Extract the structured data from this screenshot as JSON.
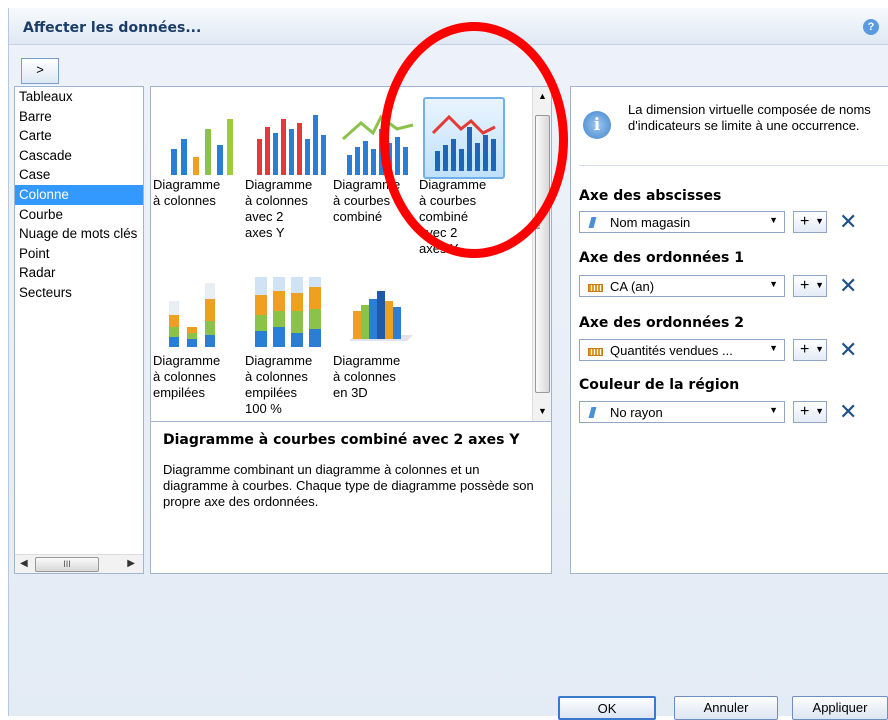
{
  "dialog": {
    "title": "Affecter les données...",
    "help_glyph": "?",
    "expand_label": ">"
  },
  "type_list": {
    "items": [
      "Tableaux",
      "Barre",
      "Carte",
      "Cascade",
      "Case",
      "Colonne",
      "Courbe",
      "Nuage de mots clés",
      "Point",
      "Radar",
      "Secteurs"
    ],
    "selected": "Colonne",
    "scroll_thumb_glyph": "III"
  },
  "gallery": {
    "charts": [
      {
        "label": "Diagramme\nà colonnes",
        "icon": "bar-chart-icon"
      },
      {
        "label": "Diagramme\nà colonnes\navec 2\naxes Y",
        "icon": "dual-axis-bar-chart-icon"
      },
      {
        "label": "Diagramme\nà courbes\ncombiné",
        "icon": "combined-line-bar-chart-icon"
      },
      {
        "label": "Diagramme\nà courbes\ncombiné\navec 2\naxes Y",
        "icon": "combined-line-bar-2axis-chart-icon",
        "selected": true
      },
      {
        "label": "Diagramme\nà colonnes\nempilées",
        "icon": "stacked-bar-chart-icon"
      },
      {
        "label": "Diagramme\nà colonnes\nempilées\n100 %",
        "icon": "stacked-100-bar-chart-icon"
      },
      {
        "label": "Diagramme\nà colonnes\nen 3D",
        "icon": "3d-bar-chart-icon"
      }
    ]
  },
  "description": {
    "title": "Diagramme à courbes combiné avec 2 axes Y",
    "text": "Diagramme combinant un diagramme à colonnes et un diagramme à courbes. Chaque type de diagramme possède son propre axe des ordonnées."
  },
  "right_panel": {
    "info_text": "La dimension virtuelle composée de noms d'indicateurs se limite à une occurrence.",
    "info_glyph": "i",
    "axes": [
      {
        "label": "Axe des abscisses",
        "value": "Nom magasin",
        "kind": "dimension"
      },
      {
        "label": "Axe des ordonnées 1",
        "value": "CA (an)",
        "kind": "measure"
      },
      {
        "label": "Axe des ordonnées 2",
        "value": "Quantités vendues ...",
        "kind": "measure"
      },
      {
        "label": "Couleur de la région",
        "value": "No rayon",
        "kind": "dimension"
      }
    ],
    "plus_glyph": "+",
    "remove_glyph": "✕"
  },
  "buttons": {
    "ok": "OK",
    "cancel": "Annuler",
    "apply": "Appliquer"
  },
  "colors": {
    "selection": "#3399ff",
    "annotation": "#ff0000",
    "title": "#1a3c66"
  }
}
